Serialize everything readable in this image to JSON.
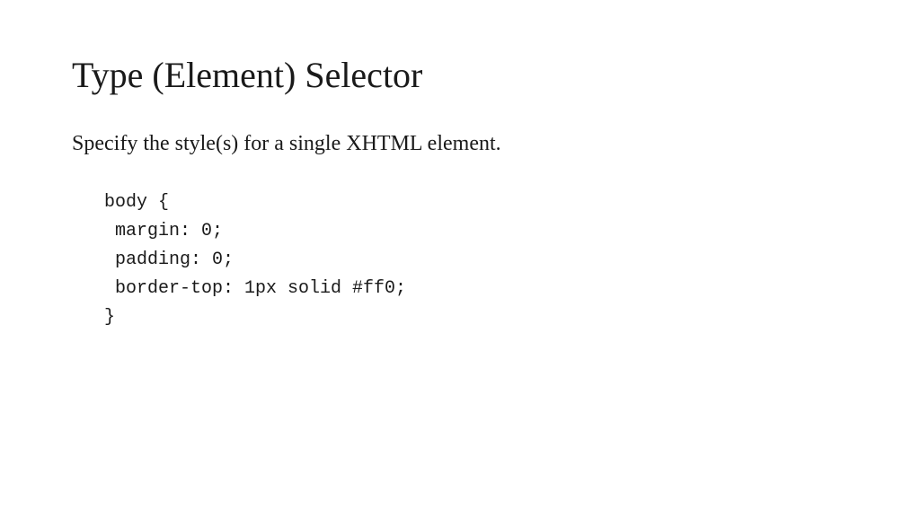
{
  "title": "Type (Element) Selector",
  "subtitle": "Specify the style(s) for a single XHTML element.",
  "code": "body {\n margin: 0;\n padding: 0;\n border-top: 1px solid #ff0;\n}"
}
